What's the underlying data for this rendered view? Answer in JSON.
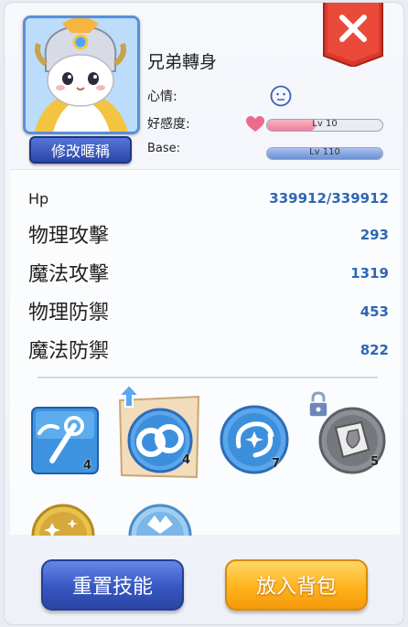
{
  "pet": {
    "name": "兄弟轉身",
    "rename_label": "修改暱稱",
    "mood_label": "心情:",
    "affection_label": "好感度:",
    "base_label": "Base:",
    "affection_level": "Lv 10",
    "affection_progress": 0.42,
    "base_level": "Lv 110",
    "base_progress": 1.0
  },
  "stats": [
    {
      "label": "Hp",
      "value": "339912/339912"
    },
    {
      "label": "物理攻擊",
      "value": "293"
    },
    {
      "label": "魔法攻擊",
      "value": "1319"
    },
    {
      "label": "物理防禦",
      "value": "453"
    },
    {
      "label": "魔法防禦",
      "value": "822"
    }
  ],
  "skills": [
    {
      "icon": "magic-staff-icon",
      "count": "4"
    },
    {
      "icon": "linked-rings-icon",
      "count": "4"
    },
    {
      "icon": "swirl-star-icon",
      "count": "7"
    },
    {
      "icon": "shield-book-icon",
      "count": "5"
    }
  ],
  "buttons": {
    "reset": "重置技能",
    "store": "放入背包"
  },
  "colors": {
    "stat_value": "#2e67b3",
    "btn_blue": "#3657c2",
    "btn_orange": "#ffb21c",
    "close_red": "#d9382b"
  }
}
